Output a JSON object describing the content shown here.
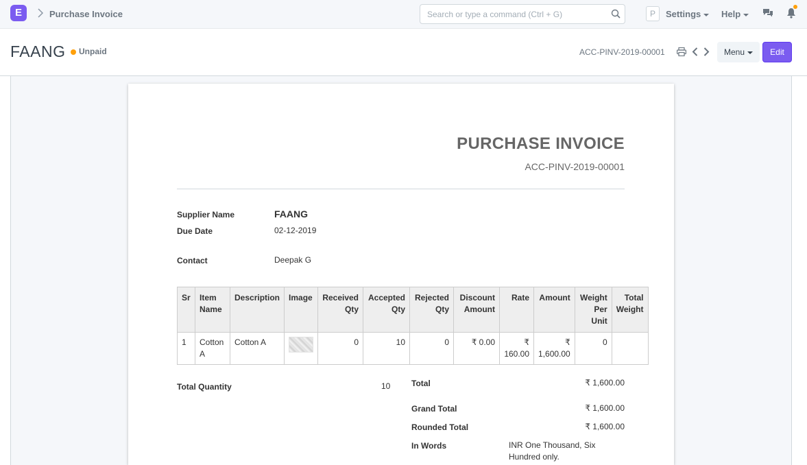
{
  "navbar": {
    "logo_letter": "E",
    "breadcrumb": "Purchase Invoice",
    "search_placeholder": "Search or type a command (Ctrl + G)",
    "avatar_letter": "P",
    "settings_label": "Settings",
    "help_label": "Help"
  },
  "page_head": {
    "title": "FAANG",
    "status": "Unpaid",
    "doc_id": "ACC-PINV-2019-00001",
    "menu_label": "Menu",
    "edit_label": "Edit"
  },
  "invoice": {
    "heading": "PURCHASE INVOICE",
    "number": "ACC-PINV-2019-00001",
    "supplier_label": "Supplier Name",
    "supplier_value": "FAANG",
    "due_label": "Due Date",
    "due_value": "02-12-2019",
    "contact_label": "Contact",
    "contact_value": "Deepak G",
    "columns": [
      "Sr",
      "Item Name",
      "Description",
      "Image",
      "Received Qty",
      "Accepted Qty",
      "Rejected Qty",
      "Discount Amount",
      "Rate",
      "Amount",
      "Weight Per Unit",
      "Total Weight"
    ],
    "rows": [
      {
        "sr": "1",
        "item_name": "Cotton A",
        "description": "Cotton A",
        "received_qty": "0",
        "accepted_qty": "10",
        "rejected_qty": "0",
        "discount_amount": "₹ 0.00",
        "rate": "₹ 160.00",
        "amount": "₹ 1,600.00",
        "weight_per_unit": "0",
        "total_weight": ""
      }
    ],
    "total_qty_label": "Total Quantity",
    "total_qty_value": "10",
    "total_label": "Total",
    "total_value": "₹ 1,600.00",
    "grand_total_label": "Grand Total",
    "grand_total_value": "₹ 1,600.00",
    "rounded_total_label": "Rounded Total",
    "rounded_total_value": "₹ 1,600.00",
    "in_words_label": "In Words",
    "in_words_value": "INR One Thousand, Six Hundred only."
  }
}
